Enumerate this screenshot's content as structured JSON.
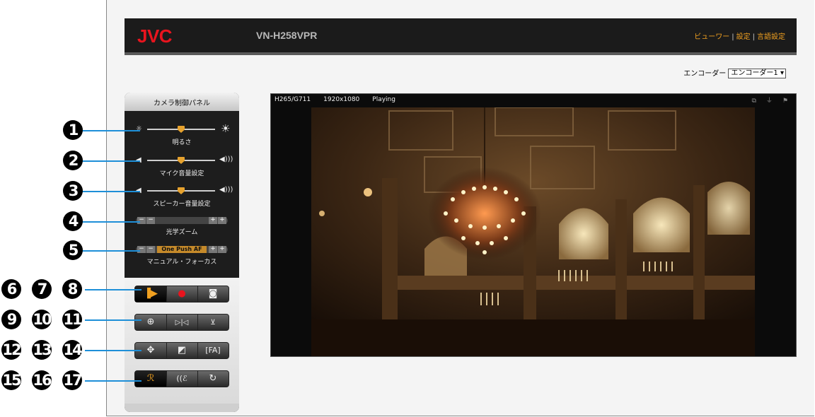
{
  "header": {
    "logo": "JVC",
    "model": "VN-H258VPR",
    "nav": [
      {
        "label": "ビューワー"
      },
      {
        "label": "設定"
      },
      {
        "label": "言語設定"
      }
    ],
    "separator": "|"
  },
  "encoder": {
    "label": "エンコーダー",
    "selected": "エンコーダー1"
  },
  "panel": {
    "title": "カメラ制御パネル",
    "brightness_label": "明るさ",
    "mic_label": "マイク音量設定",
    "speaker_label": "スピーカー音量設定",
    "zoom_label": "光学ズーム",
    "focus_label": "マニュアル・フォーカス",
    "focus_button": "One Push AF",
    "minus": "−",
    "plus": "+",
    "slider_levels": {
      "brightness": 0.5,
      "mic": 0.5,
      "speaker": 0.5
    }
  },
  "video": {
    "codec": "H265/G711",
    "resolution": "1920x1080",
    "status": "Playing"
  },
  "badges": [
    "1",
    "2",
    "3",
    "4",
    "5",
    "6",
    "7",
    "8",
    "9",
    "10",
    "11",
    "12",
    "13",
    "14",
    "15",
    "16",
    "17"
  ],
  "colors": {
    "accent": "#f0a020",
    "logo": "#e8141e",
    "leader": "#1e8fd8"
  }
}
